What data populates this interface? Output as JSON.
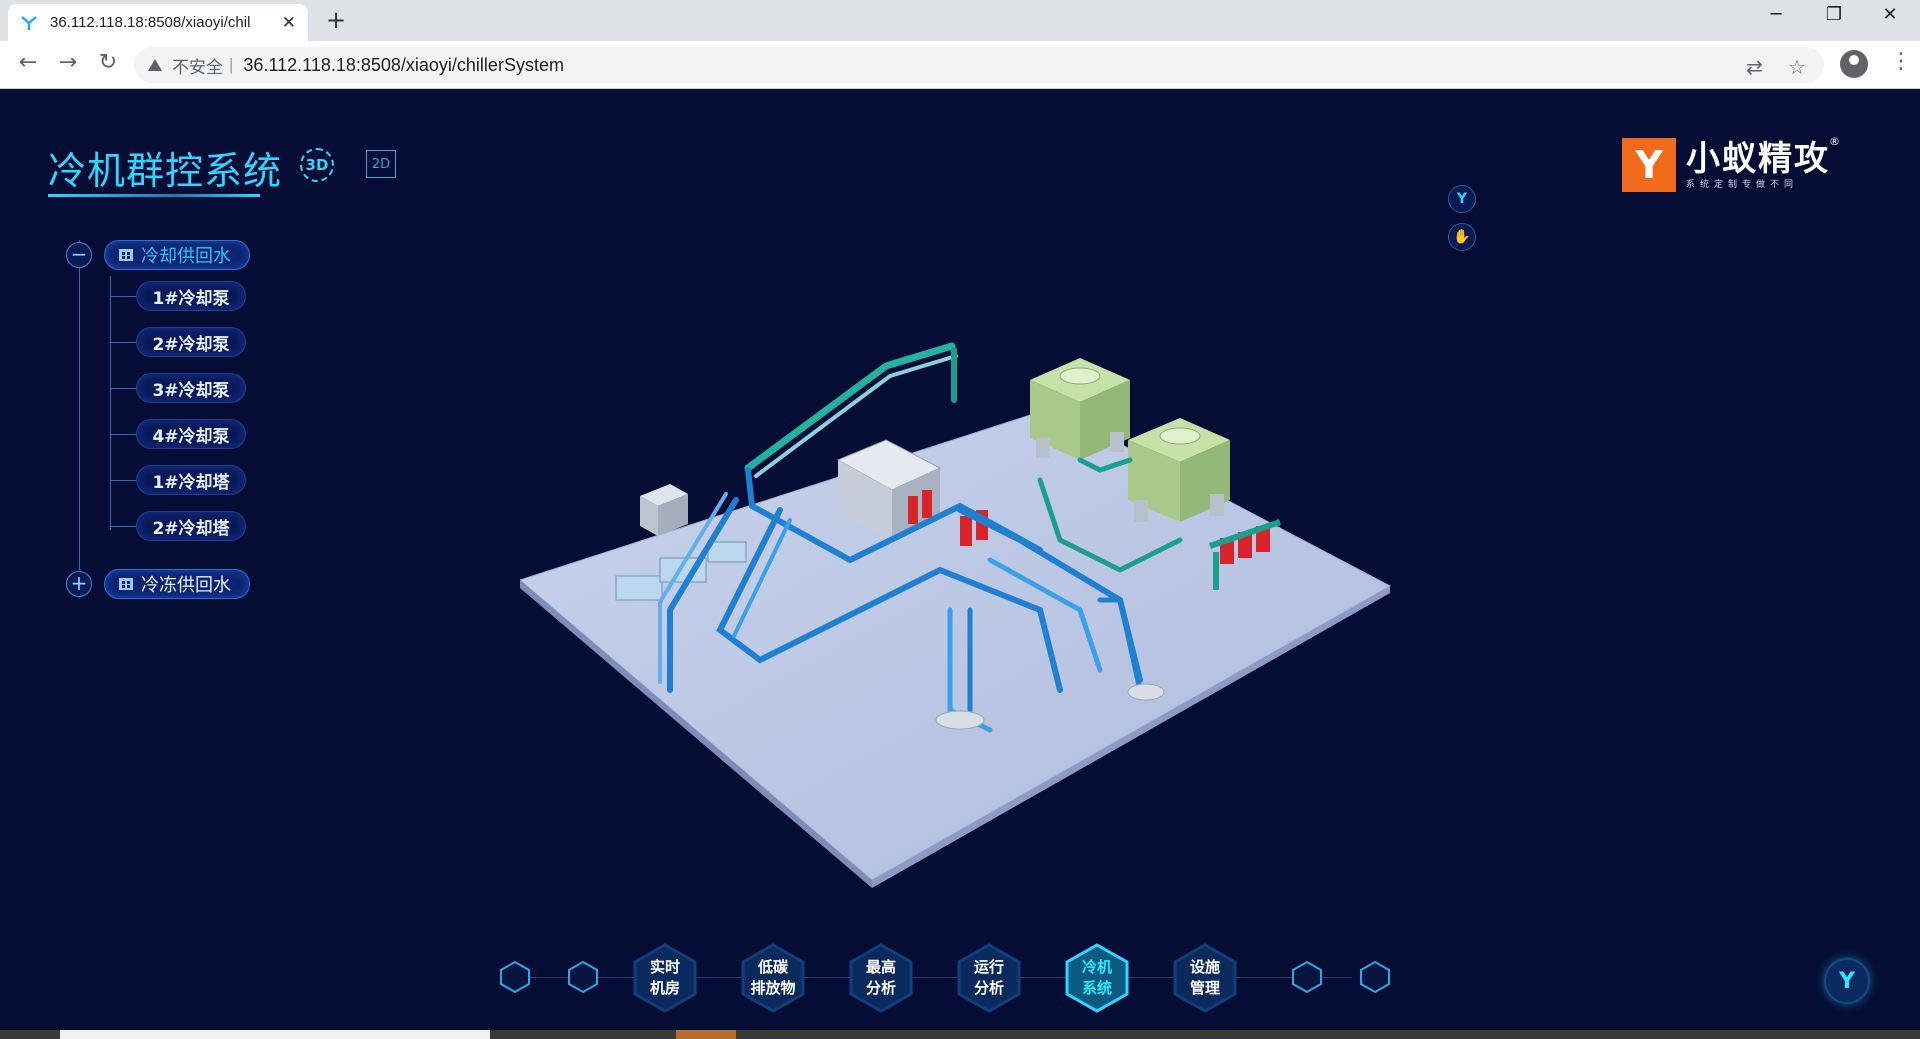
{
  "browser": {
    "tab_title": "36.112.118.18:8508/xiaoyi/chil",
    "insecure_label": "不安全",
    "url": "36.112.118.18:8508/xiaoyi/chillerSystem"
  },
  "app": {
    "title": "冷机群控系统",
    "view_3d": "3D",
    "view_2d": "2D",
    "logo": {
      "name": "小蚁精攻",
      "sub": "系统定制专做不同",
      "mark": "Y",
      "reg": "®"
    },
    "tree": {
      "groups": [
        {
          "label": "冷却供回水",
          "toggle": "−",
          "expanded": true
        },
        {
          "label": "冷冻供回水",
          "toggle": "+",
          "expanded": false
        }
      ],
      "items": [
        "1#冷却泵",
        "2#冷却泵",
        "3#冷却泵",
        "4#冷却泵",
        "1#冷却塔",
        "2#冷却塔"
      ]
    },
    "side_controls": [
      "Y",
      "✋"
    ],
    "bottom_nav": [
      {
        "line1": "实时",
        "line2": "机房",
        "active": false
      },
      {
        "line1": "低碳",
        "line2": "排放物",
        "active": false
      },
      {
        "line1": "最高",
        "line2": "分析",
        "active": false
      },
      {
        "line1": "运行",
        "line2": "分析",
        "active": false
      },
      {
        "line1": "冷机",
        "line2": "系统",
        "active": true
      },
      {
        "line1": "设施",
        "line2": "管理",
        "active": false
      }
    ],
    "corner_button": "Y",
    "colors": {
      "accent": "#2fd6ff",
      "background": "#050d35",
      "logo_orange": "#f26b1d"
    }
  }
}
